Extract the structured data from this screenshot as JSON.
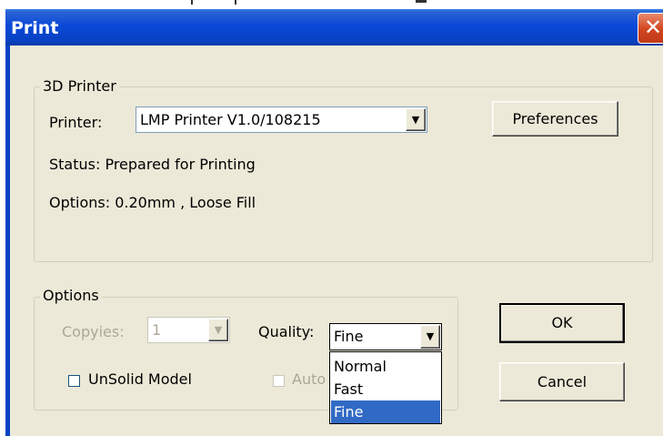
{
  "window": {
    "title": "Print",
    "close_glyph": "✕"
  },
  "printer_group": {
    "legend": "3D Printer",
    "printer_label": "Printer:",
    "printer_value": "LMP Printer V1.0/108215",
    "status": "Status: Prepared for Printing",
    "options_text": "Options: 0.20mm , Loose Fill",
    "preferences_label": "Preferences"
  },
  "options_group": {
    "legend": "Options",
    "copies_label": "Copyies:",
    "copies_value": "1",
    "quality_label": "Quality:",
    "quality_value": "Fine",
    "unsolid_label": "UnSolid Model",
    "auto_label": "Auto"
  },
  "quality_dropdown": {
    "options": [
      "Normal",
      "Fast",
      "Fine"
    ],
    "selected": "Fine"
  },
  "buttons": {
    "ok": "OK",
    "cancel": "Cancel"
  },
  "icons": {
    "dropdown_arrow": "▼",
    "close": "close-icon"
  },
  "colors": {
    "titlebar": "#0a49d8",
    "dialog_bg": "#ece9d8",
    "selection": "#316ac5",
    "close_button": "#d2451f"
  }
}
